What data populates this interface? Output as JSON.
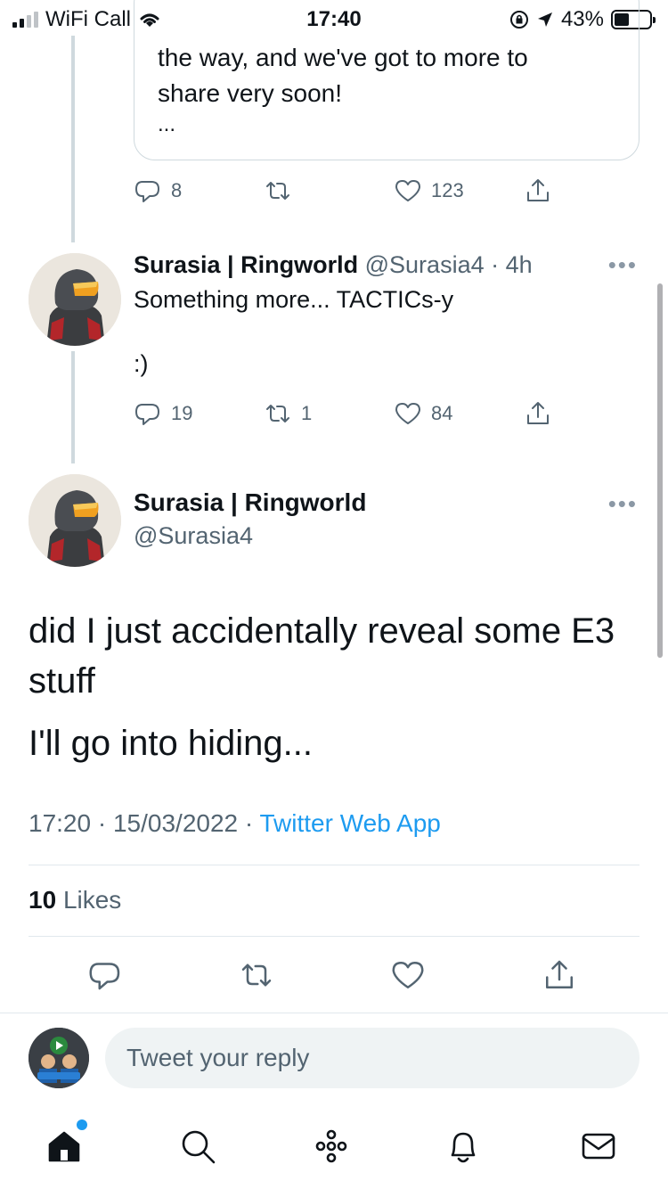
{
  "status_bar": {
    "carrier": "WiFi Call",
    "time": "17:40",
    "battery": "43%",
    "battery_level": 0.43
  },
  "quoted_tweet_fragment": {
    "lines": "the way, and we've got to more to\nshare very soon!",
    "ellipsis": "..."
  },
  "thread_tweet_1": {
    "replies": "8",
    "retweets": "",
    "likes": "123"
  },
  "thread_tweet_2": {
    "name": "Surasia | Ringworld",
    "handle": "@Surasia4",
    "time": "· 4h",
    "text": "Something more... TACTICs-y\n\n:)",
    "replies": "19",
    "retweets": "1",
    "likes": "84"
  },
  "main_tweet": {
    "name": "Surasia | Ringworld",
    "handle": "@Surasia4",
    "text_line_1": "did I just accidentally reveal some E3 stuff",
    "text_line_2": "I'll go into hiding...",
    "time": "17:20",
    "date": "15/03/2022",
    "source": "Twitter Web App",
    "likes_count": "10",
    "likes_label": "Likes"
  },
  "more_label": "•••",
  "reply_bar": {
    "placeholder": "Tweet your reply"
  },
  "icons": {
    "reply": "reply-icon",
    "retweet": "retweet-icon",
    "like": "heart-icon",
    "share": "share-icon",
    "home": "home-icon",
    "search": "search-icon",
    "spaces": "spaces-icon",
    "notifications": "bell-icon",
    "messages": "mail-icon"
  },
  "colors": {
    "accent": "#1d9bf0",
    "text": "#0f1419",
    "muted": "#536471",
    "border": "#cfd9de"
  }
}
